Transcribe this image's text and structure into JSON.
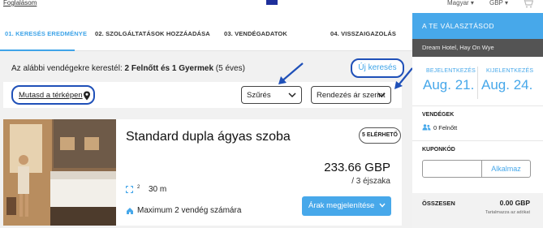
{
  "topbar": {
    "booking_link": "Foglalásom",
    "language": "Magyar ▾",
    "currency": "GBP ▾",
    "cart_icon": "cart-icon"
  },
  "steps": [
    {
      "label": "01. KERESÉS EREDMÉNYE",
      "active": true
    },
    {
      "label": "02. SZOLGÁLTATÁSOK HOZZÁADÁSA",
      "active": false
    },
    {
      "label": "03. VENDÉGADATOK",
      "active": false
    },
    {
      "label": "04. VISSZAIGAZOLÁS",
      "active": false
    }
  ],
  "search": {
    "prefix": "Az alábbi vendégekre kerestél: ",
    "guests_bold": "2 Felnőtt és 1 Gyermek",
    "suffix": " (5 éves)",
    "new_search": "Új keresés"
  },
  "filters": {
    "map_link": "Mutasd a térképen",
    "map_icon": "map-pin-icon",
    "filter_label": "Szűrés",
    "sort_label": "Rendezés ár szerint"
  },
  "room": {
    "title": "Standard dupla ágyas szoba",
    "availability": "5 ELÉRHETŐ",
    "price": "233.66 GBP",
    "nights": "/ 3 éjszaka",
    "area_value": "30 m",
    "area_sup": "2",
    "max_guests": "Maximum 2 vendég számára",
    "price_button": "Árak megjelenítése"
  },
  "sidebar": {
    "header": "A TE VÁLASZTÁSOD",
    "hotel": "Dream Hotel, Hay On Wye",
    "checkin_label": "BEJELENTKEZÉS",
    "checkin_value": "Aug. 21.",
    "checkout_label": "KIJELENTKEZÉS",
    "checkout_value": "Aug. 24.",
    "guests_label": "VENDÉGEK",
    "guests_value": "0 Felnőtt",
    "coupon_label": "KUPONKÓD",
    "coupon_button": "Alkalmaz",
    "total_label": "ÖSSZESEN",
    "total_value": "0.00 GBP",
    "tax_note": "Tartalmazza az adókat"
  },
  "colors": {
    "accent": "#47a8ea",
    "highlight_outline": "#1f50b8",
    "hotel_bar": "#545454"
  }
}
